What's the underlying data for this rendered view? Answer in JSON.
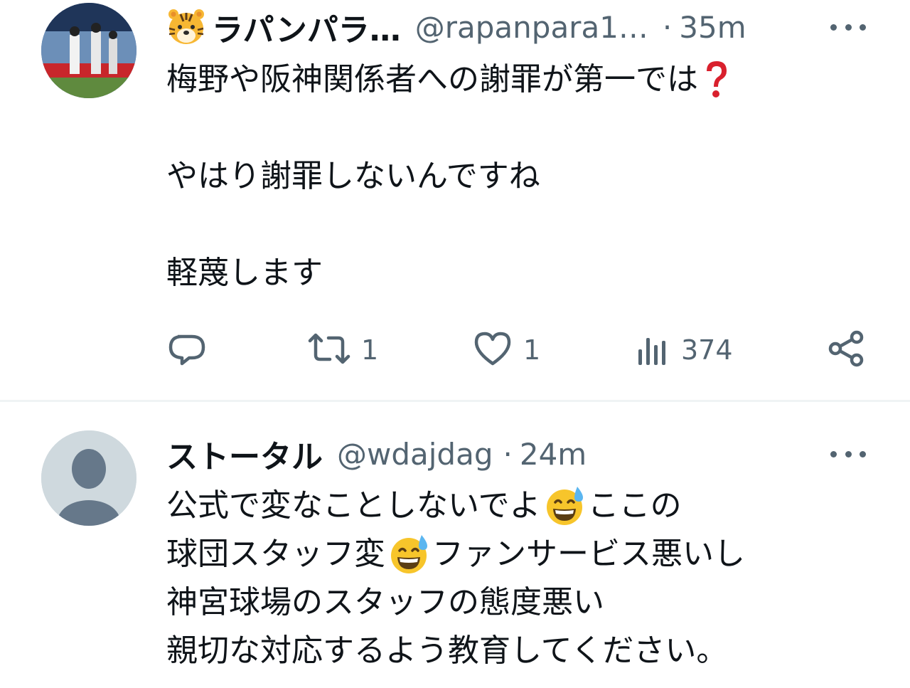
{
  "tweets": [
    {
      "name_emoji": "tiger-face",
      "name": "ラパンパラ…",
      "handle": "@rapanpara1…",
      "separator": "·",
      "time": "35m",
      "lines": [
        "梅野や阪神関係者への謝罪が第一では",
        "",
        "やはり謝罪しないんですね",
        "",
        "軽蔑します"
      ],
      "line1_end_emoji": "red-question-mark",
      "stats": {
        "replies": "",
        "retweets": "1",
        "likes": "1",
        "views": "374"
      }
    },
    {
      "name": "ストータル",
      "handle": "@wdajdag",
      "separator": "·",
      "time": "24m",
      "line1_a": "公式で変なことしないでよ",
      "line1_b": "ここの",
      "line2_a": "球団スタッフ変",
      "line2_b": "ファンサービス悪いし",
      "line3": "神宮球場のスタッフの態度悪い",
      "line4": "親切な対応するよう教育してください。",
      "inline_emoji": "grinning-face-with-sweat"
    }
  ],
  "colors": {
    "text": "#0f1419",
    "secondary": "#536471",
    "divider": "#eff3f4",
    "default_avatar_bg": "#cfd9de",
    "default_avatar_fg": "#66788a"
  }
}
